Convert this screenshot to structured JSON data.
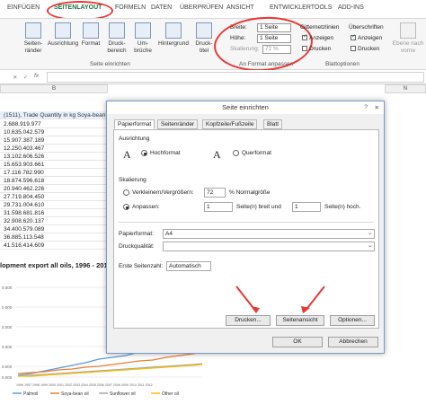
{
  "ribbon_tabs": [
    "EINFÜGEN",
    "SEITENLAYOUT",
    "FORMELN",
    "DATEN",
    "ÜBERPRÜFEN",
    "ANSICHT",
    "ENTWICKLERTOOLS",
    "ADD-INS"
  ],
  "ribbon": {
    "buttons": [
      "Seiten-\nränder",
      "Ausrichtung",
      "Format",
      "Druck-\nbereich",
      "Um-\nbrüche",
      "Hintergrund",
      "Druck-\ntitel"
    ],
    "group_seite": "Seite einrichten",
    "breite_label": "Breite:",
    "breite_value": "1 Seite",
    "hoehe_label": "Höhe:",
    "hoehe_value": "1 Seite",
    "skalierung_label": "Skalierung:",
    "skalierung_value": "72 %",
    "group_anpassen": "An Format anpassen",
    "gitternetz": "Gitternetzlinien",
    "ueberschriften": "Überschriften",
    "anzeigen1": "Anzeigen",
    "anzeigen2": "Anzeigen",
    "drucken1": "Drucken",
    "drucken2": "Drucken",
    "group_blatt": "Blattoptionen",
    "ebene_nach_vorne": "Ebene nach vorne",
    "ebene_nach": "Ebene nach"
  },
  "formula_bar": {
    "name_box": "",
    "fx": "fx"
  },
  "sheet": {
    "col_b": "B",
    "col_n": "N",
    "header_cell": "(1511), Trade Quantity in kg",
    "header_cell2": "Soya-bean oil",
    "values": [
      "2.688.919.977",
      "10.635.042.579",
      "15.907.387.189",
      "12.250.403.467",
      "13.102.606.526",
      "15.653.903.661",
      "17.116.782.990",
      "18.874.596.618",
      "20.940.462.226",
      "27.719.804.450",
      "29.731.004.610",
      "31.598.681.816",
      "32.908.620.137",
      "34.400.579.089",
      "36.885.113.548",
      "41.516.414.609"
    ],
    "chart_title": "lopment export all oils, 1996 - 201",
    "legend": [
      "Palmoil",
      "Soya-bean oil",
      "Sunflower oil",
      "Other oil"
    ],
    "years": "1996 1997 1998 1999 2000 2001 2002 2003 2004 2005 2006 2007 2008 2009 2010 2011 2012",
    "y_labels": [
      "0.000",
      "0.000",
      "0.000",
      "0.000",
      "0.000",
      "0.000"
    ]
  },
  "dialog": {
    "title": "Seite einrichten",
    "help": "?",
    "close": "✕",
    "tabs": [
      "Papierformat",
      "Seitenränder",
      "Kopfzeile/Fußzeile",
      "Blatt"
    ],
    "ausrichtung": "Ausrichtung",
    "hochformat": "Hochformat",
    "querformat": "Querformat",
    "skalierung": "Skalierung",
    "verkleinern": "Verkleinern/Vergrößern:",
    "verkleinern_value": "72",
    "normalgroesse": "% Normalgröße",
    "anpassen": "Anpassen:",
    "anpassen_w": "1",
    "seiten_breit": "Seite(n) breit und",
    "anpassen_h": "1",
    "seiten_hoch": "Seite(n) hoch.",
    "papierformat_label": "Papierformat:",
    "papierformat_value": "A4",
    "druckqualitaet_label": "Druckqualität:",
    "druckqualitaet_value": "",
    "erste_seitenzahl_label": "Erste Seitenzahl:",
    "erste_seitenzahl_value": "Automatisch",
    "drucken_btn": "Drucken...",
    "seitenansicht_btn": "Seitenansicht",
    "optionen_btn": "Optionen...",
    "ok_btn": "OK",
    "abbrechen_btn": "Abbrechen"
  },
  "colors": {
    "accent": "#217346",
    "annotation": "#e53935",
    "dialog_border": "#7a9cc7"
  }
}
